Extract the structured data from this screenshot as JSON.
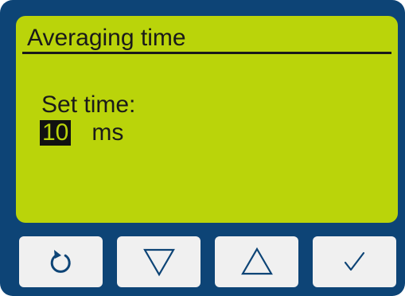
{
  "screen": {
    "title": "Averaging time",
    "prompt": "Set time:",
    "value": "10",
    "unit": "ms"
  },
  "buttons": [
    {
      "name": "reset",
      "icon": "refresh-icon"
    },
    {
      "name": "down",
      "icon": "triangle-down-icon"
    },
    {
      "name": "up",
      "icon": "triangle-up-icon"
    },
    {
      "name": "confirm",
      "icon": "checkmark-icon"
    }
  ],
  "colors": {
    "bezel": "#0d4476",
    "lcd": "#bad40a",
    "text": "#1a1a1a",
    "button": "#f0f0f0",
    "icon": "#0d4476"
  }
}
